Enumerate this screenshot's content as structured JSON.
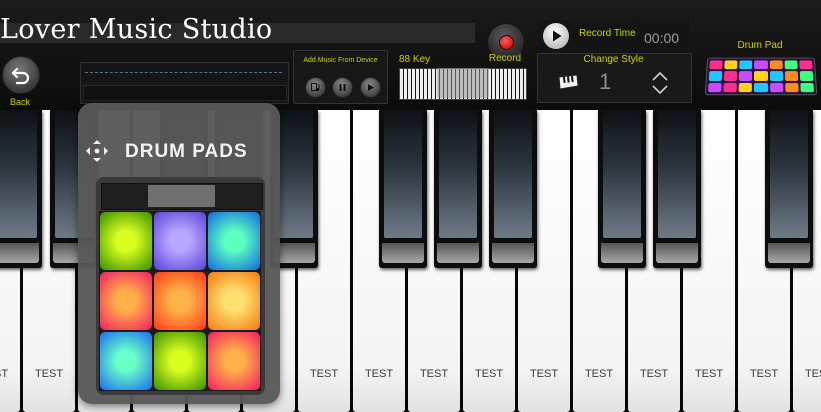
{
  "header": {
    "app_title": "Lover Music Studio",
    "back_label": "Back",
    "add_music_label": "Add Music From Device",
    "key88_label": "88 Key",
    "record_label": "Record",
    "record_time_label": "Record Time",
    "record_time_value": "00:00",
    "change_style_label": "Change Style",
    "style_number": "1",
    "drum_pad_label": "Drum Pad"
  },
  "colors": {
    "label_accent": "#c8d400",
    "record_red": "#e00000"
  },
  "icons": {
    "back": "undo-arrow-icon",
    "add_music": "music-file-icon",
    "pause": "pause-icon",
    "play": "play-icon",
    "record": "record-dot-icon",
    "style_instrument": "piano-icon",
    "style_spinner": "up-down-chevron-icon",
    "drag": "move-arrows-icon"
  },
  "drum_panel": {
    "title": "DRUM PADS",
    "pads": [
      {
        "name": "drum-pad-1",
        "inner": "#d8ff1e",
        "outer": "#3a8e00"
      },
      {
        "name": "drum-pad-2",
        "inner": "#b9a8ff",
        "outer": "#5b40d8"
      },
      {
        "name": "drum-pad-3",
        "inner": "#5cffc0",
        "outer": "#1168e0"
      },
      {
        "name": "drum-pad-4",
        "inner": "#ffb04a",
        "outer": "#f01e60"
      },
      {
        "name": "drum-pad-5",
        "inner": "#ffb24a",
        "outer": "#ff3a14"
      },
      {
        "name": "drum-pad-6",
        "inner": "#ffe070",
        "outer": "#f07a10"
      },
      {
        "name": "drum-pad-7",
        "inner": "#6affc8",
        "outer": "#1a6cf0"
      },
      {
        "name": "drum-pad-8",
        "inner": "#d8ff1e",
        "outer": "#3a8e00"
      },
      {
        "name": "drum-pad-9",
        "inner": "#ffb04a",
        "outer": "#f01e60"
      }
    ]
  },
  "drumpad_thumbnail_colors": [
    "#ff2e8a",
    "#ffd21e",
    "#20c8ff",
    "#c84cff",
    "#ff8a1e",
    "#3cff7a",
    "#ff2e8a",
    "#20c8ff",
    "#ff2e8a",
    "#c84cff",
    "#ffd21e",
    "#20c8ff",
    "#ff8a1e",
    "#3cff7a",
    "#c84cff",
    "#ff2e8a",
    "#ffd21e",
    "#20c8ff",
    "#c84cff",
    "#ff8a1e",
    "#3cff7a"
  ],
  "keyboard": {
    "white_key_labels": [
      "TEST",
      "TEST",
      "",
      "",
      "",
      "",
      "TEST",
      "TEST",
      "TEST",
      "TEST",
      "TEST",
      "TEST",
      "TEST",
      "TEST",
      "TEST",
      "TEST"
    ]
  }
}
